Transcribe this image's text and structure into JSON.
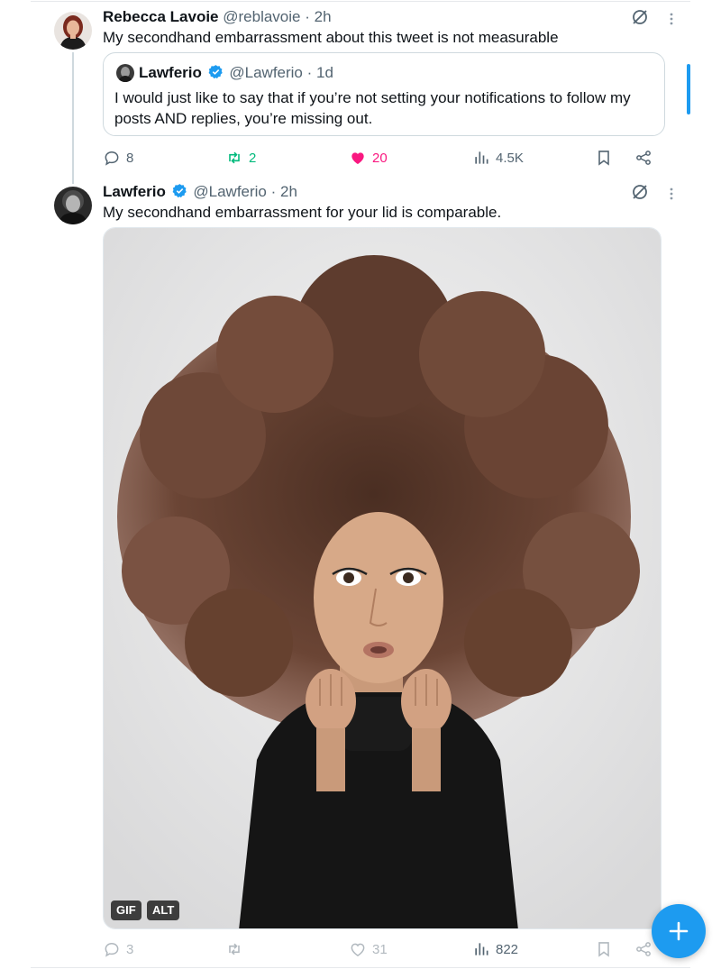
{
  "tweet1": {
    "name": "Rebecca Lavoie",
    "handle": "@reblavoie",
    "separator": "·",
    "time": "2h",
    "text": "My secondhand embarrassment about this tweet is not measurable",
    "quote": {
      "name": "Lawferio",
      "handle": "@Lawferio",
      "separator": "·",
      "time": "1d",
      "text": "I would just like to say that if you’re not setting your notifications to follow my posts AND replies, you’re missing out."
    },
    "actions": {
      "replies": "8",
      "reposts": "2",
      "likes": "20",
      "views": "4.5K"
    }
  },
  "tweet2": {
    "name": "Lawferio",
    "handle": "@Lawferio",
    "separator": "·",
    "time": "2h",
    "text": "My secondhand embarrassment for your lid is comparable.",
    "media": {
      "badges": [
        "GIF",
        "ALT"
      ]
    },
    "actions": {
      "replies": "3",
      "reposts": "",
      "likes": "31",
      "views": "822"
    }
  },
  "colors": {
    "accent": "#1d9bf0",
    "repost_active": "#00ba7c",
    "like_active": "#f91880",
    "secondary_text": "#536471"
  },
  "icons": [
    "grok-icon",
    "more-icon",
    "verified-icon",
    "reply-icon",
    "repost-icon",
    "like-icon",
    "views-icon",
    "bookmark-icon",
    "share-icon",
    "compose-plus-icon"
  ]
}
